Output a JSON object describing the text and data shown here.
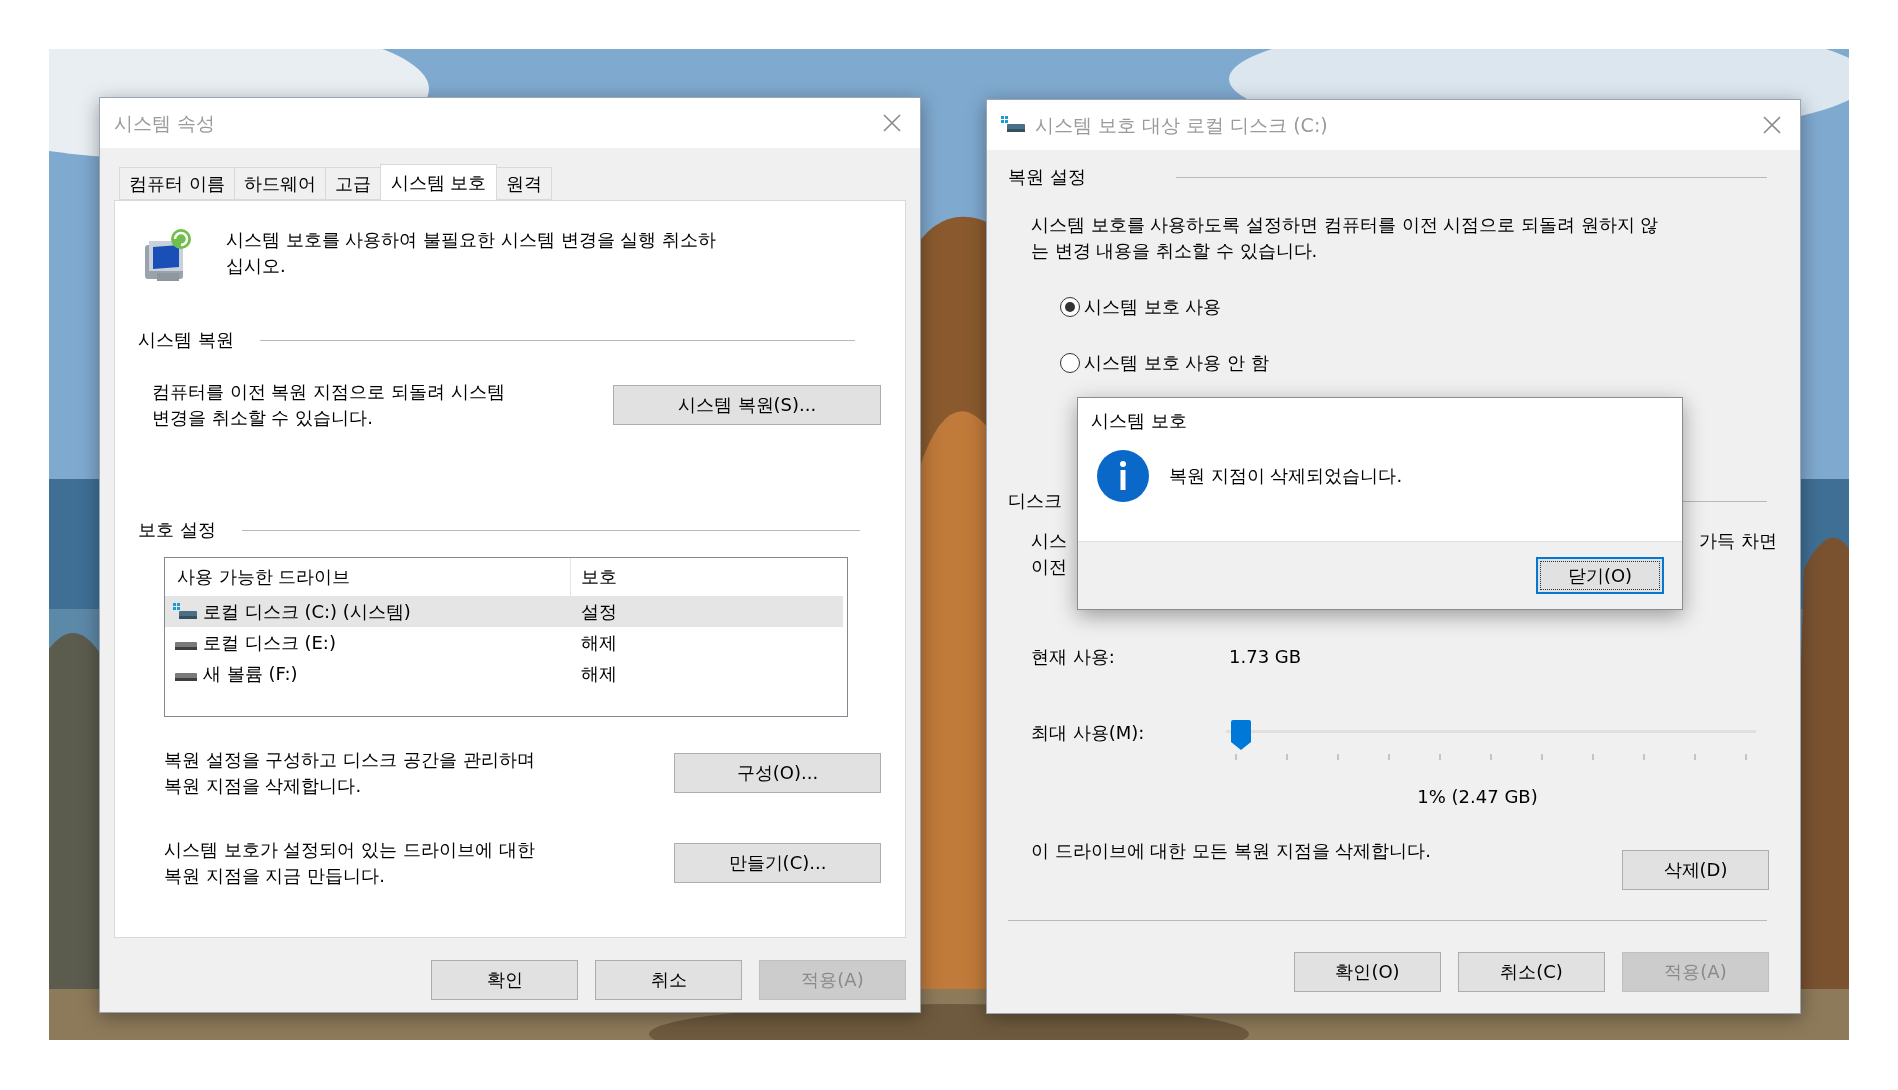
{
  "system_properties": {
    "title": "시스템 속성",
    "tabs": [
      {
        "label": "컴퓨터 이름",
        "selected": false
      },
      {
        "label": "하드웨어",
        "selected": false
      },
      {
        "label": "고급",
        "selected": false
      },
      {
        "label": "시스템 보호",
        "selected": true
      },
      {
        "label": "원격",
        "selected": false
      }
    ],
    "intro": "시스템 보호를 사용하여 불필요한 시스템 변경을 실행 취소하\n십시오.",
    "restore_section": {
      "heading": "시스템 복원",
      "description": "컴퓨터를 이전 복원 지점으로 되돌려 시스템\n변경을 취소할 수 있습니다.",
      "button": "시스템 복원(S)..."
    },
    "protection_section": {
      "heading": "보호 설정",
      "columns": [
        "사용 가능한 드라이브",
        "보호"
      ],
      "drives": [
        {
          "kind": "system",
          "name": "로컬 디스크 (C:) (시스템)",
          "protection": "설정",
          "selected": true
        },
        {
          "kind": "disk",
          "name": "로컬 디스크 (E:)",
          "protection": "해제",
          "selected": false
        },
        {
          "kind": "disk",
          "name": "새 볼륨 (F:)",
          "protection": "해제",
          "selected": false
        }
      ],
      "actions": [
        {
          "description": "복원 설정을 구성하고 디스크 공간을 관리하며\n복원 지점을 삭제합니다.",
          "button": "구성(O)..."
        },
        {
          "description": "시스템 보호가 설정되어 있는 드라이브에 대한\n복원 지점을 지금 만듭니다.",
          "button": "만들기(C)..."
        }
      ]
    },
    "buttons": [
      {
        "label": "확인",
        "disabled": false
      },
      {
        "label": "취소",
        "disabled": false
      },
      {
        "label": "적용(A)",
        "disabled": true
      }
    ]
  },
  "drive_protection": {
    "title": "시스템 보호 대상 로컬 디스크 (C:)",
    "restore_heading": "복원 설정",
    "restore_text": "시스템 보호를 사용하도록 설정하면 컴퓨터를 이전 시점으로 되돌려 원하지 않\n는 변경 내용을 취소할 수 있습니다.",
    "options": [
      {
        "label": "시스템 보호 사용",
        "selected": true
      },
      {
        "label": "시스템 보호 사용 안 함",
        "selected": false
      }
    ],
    "disk_heading": "디스크",
    "disk_text_left": "시스\n이전",
    "disk_text_right": "가득 차면",
    "current_usage_label": "현재 사용:",
    "current_usage": "1.73 GB",
    "max_usage_label": "최대 사용(M):",
    "max_usage": {
      "level": 0.01
    },
    "max_usage_reading": "1% (2.47 GB)",
    "delete_text": "이 드라이브에 대한 모든 복원 지점을 삭제합니다.",
    "delete_button": "삭제(D)",
    "buttons": [
      {
        "label": "확인(O)",
        "disabled": false
      },
      {
        "label": "취소(C)",
        "disabled": false
      },
      {
        "label": "적용(A)",
        "disabled": true
      }
    ]
  },
  "message_box": {
    "title": "시스템 보호",
    "message": "복원 지점이 삭제되었습니다.",
    "button": "닫기(O)",
    "focused": true
  }
}
